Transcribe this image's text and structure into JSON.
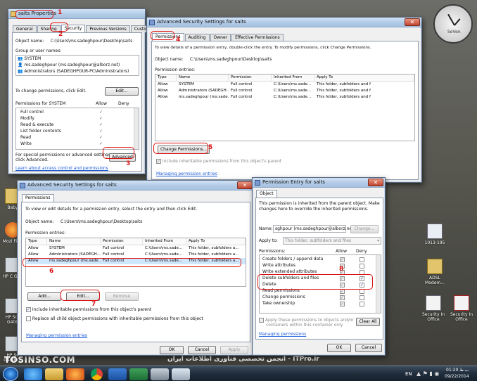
{
  "desktop": {
    "left_icons": [
      "Baby",
      "Mozi Firef",
      "HP C G40",
      "HP Sca G400",
      "HP Sc G4000 P"
    ],
    "right_icons": [
      "1013-195",
      "ADSL Modem...",
      "Security In Office",
      "Security In Office"
    ],
    "watermark": "TOSINSO.COM",
    "banner": "انجمن تخصصی فناوری اطلاعات ایران - ITPro.ir",
    "clock_label": "SeVen"
  },
  "taskbar": {
    "lang": "EN",
    "time": "01:20 ب.ظ",
    "date": "09/22/2014"
  },
  "props": {
    "title": "saits Properties",
    "tabs": [
      "General",
      "Sharing",
      "Security",
      "Previous Versions",
      "Customize"
    ],
    "object_name_label": "Object name:",
    "object_name_value": "C:\\Users\\ms.sadeghpour\\Desktop\\saits",
    "group_label": "Group or user names:",
    "users": [
      "SYSTEM",
      "ms.sadeghpour (ms.sadeghpour@alborz.net)",
      "Administrators (SADEGHPOUR-PC\\Administrators)"
    ],
    "change_text": "To change permissions, click Edit.",
    "edit_label": "Edit...",
    "perm_for": "Permissions for SYSTEM",
    "allow": "Allow",
    "deny": "Deny",
    "perms": [
      "Full control",
      "Modify",
      "Read & execute",
      "List folder contents",
      "Read",
      "Write"
    ],
    "special_text_1": "For special permissions or advanced settings,",
    "special_text_2": "click Advanced.",
    "advanced_label": "Advanced",
    "learn_link": "Learn about access control and permissions"
  },
  "adv_top": {
    "title": "Advanced Security Settings for saits",
    "tabs": [
      "Permissions",
      "Auditing",
      "Owner",
      "Effective Permissions"
    ],
    "intro": "To view details of a permission entry, double-click the entry. To modify permissions, click Change Permissions.",
    "object_name_label": "Object name:",
    "object_name_value": "C:\\Users\\ms.sadeghpour\\Desktop\\saits",
    "entries_label": "Permission entries:",
    "columns": [
      "Type",
      "Name",
      "Permission",
      "Inherited From",
      "Apply To"
    ],
    "rows": [
      [
        "Allow",
        "SYSTEM",
        "Full control",
        "C:\\Users\\ms.sade...",
        "This folder, subfolders and f"
      ],
      [
        "Allow",
        "Administrators (SADEGH...",
        "Full control",
        "C:\\Users\\ms.sade...",
        "This folder, subfolders and f"
      ],
      [
        "Allow",
        "ms.sadeghpour (ms.sade...",
        "Full control",
        "C:\\Users\\ms.sade...",
        "This folder, subfolders and f"
      ]
    ],
    "change_perm_label": "Change Permissions...",
    "include_text": "Include inheritable permissions from this object's parent",
    "manage_link": "Managing permission entries"
  },
  "adv_bottom": {
    "title": "Advanced Security Settings for saits",
    "tab": "Permissions",
    "intro": "To view or edit details for a permission entry, select the entry and then click Edit.",
    "object_name_label": "Object name:",
    "object_name_value": "C:\\Users\\ms.sadeghpour\\Desktop\\saits",
    "entries_label": "Permission entries:",
    "columns": [
      "Type",
      "Name",
      "Permission",
      "Inherited From",
      "Apply To"
    ],
    "rows": [
      [
        "Allow",
        "SYSTEM",
        "Full control",
        "C:\\Users\\ms.sade...",
        "This folder, subfolders a..."
      ],
      [
        "Allow",
        "Administrators (SADEGH...",
        "Full control",
        "C:\\Users\\ms.sade...",
        "This folder, subfolders a..."
      ],
      [
        "Allow",
        "ms.sadeghpour (ms.sade...",
        "Full control",
        "C:\\Users\\ms.sade...",
        "This folder, subfolders a..."
      ]
    ],
    "add_label": "Add...",
    "edit_label": "Edit...",
    "remove_label": "Remove",
    "include_text": "Include inheritable permissions from this object's parent",
    "replace_text": "Replace all child object permissions with inheritable permissions from this object",
    "manage_link": "Managing permission entries",
    "ok_label": "OK",
    "cancel_label": "Cancel",
    "apply_label": "Apply"
  },
  "entry": {
    "title": "Permission Entry for saits",
    "tab": "Object",
    "intro": "This permission is inherited from the parent object. Make changes here to override the inherited permissions.",
    "name_label": "Name:",
    "name_value": "sghpour (ms.sadeghpour@alborz.net)",
    "change_label": "Change...",
    "apply_to_label": "Apply to:",
    "apply_to_value": "This folder, subfolders and files",
    "perms_label": "Permissions:",
    "allow": "Allow",
    "deny": "Deny",
    "perms": [
      "Create folders / append data",
      "Write attributes",
      "Write extended attributes",
      "Delete subfolders and files",
      "Delete",
      "Read permissions",
      "Change permissions",
      "Take ownership"
    ],
    "apply_objects_text_1": "Apply these permissions to objects and/or",
    "apply_objects_text_2": "containers within this container only",
    "clear_all_label": "Clear All",
    "manage_link": "Managing permissions",
    "ok_label": "OK",
    "cancel_label": "Cancel"
  },
  "annotations": [
    "1",
    "2",
    "3",
    "4",
    "5",
    "6",
    "7",
    "8"
  ]
}
